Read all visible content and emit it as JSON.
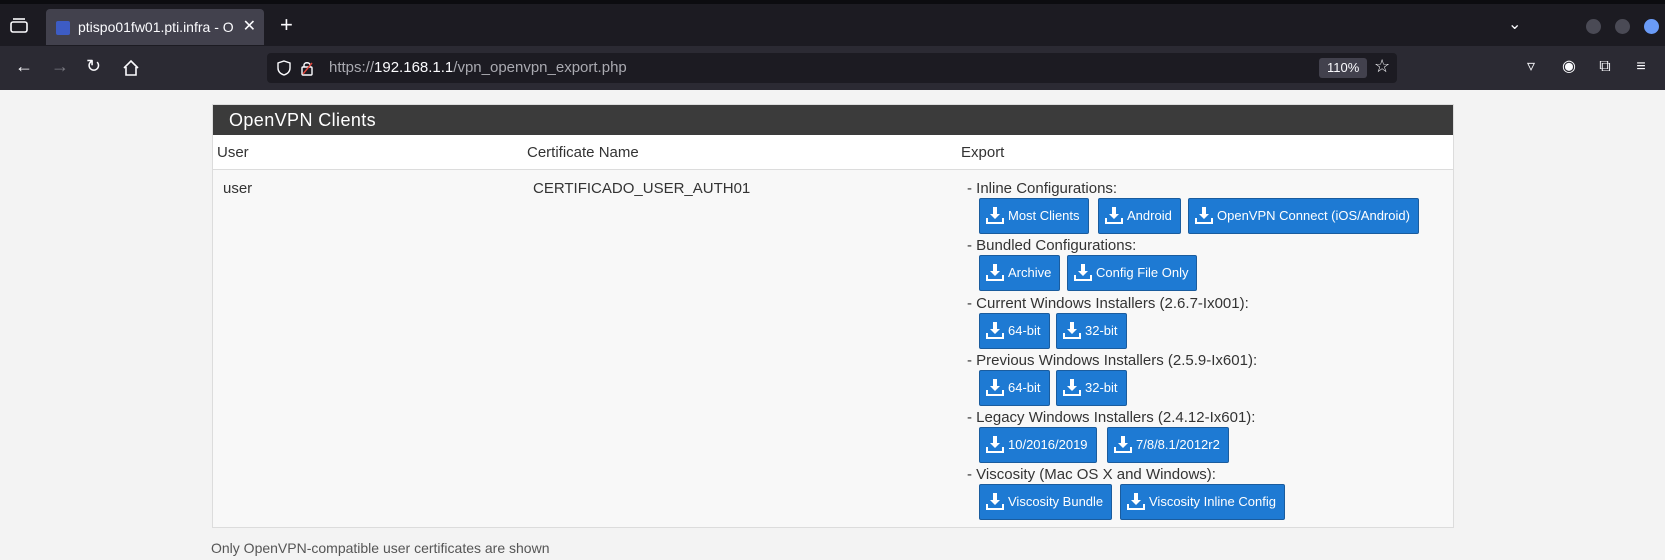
{
  "browser": {
    "tab_title": "ptispo01fw01.pti.infra - O",
    "url_scheme": "https://",
    "url_host": "192.168.1.1",
    "url_path": "/vpn_openvpn_export.php",
    "zoom": "110%"
  },
  "panel": {
    "title": "OpenVPN Clients",
    "columns": [
      "User",
      "Certificate Name",
      "Export"
    ]
  },
  "row": {
    "user": "user",
    "certificate": "CERTIFICADO_USER_AUTH01"
  },
  "export_groups": [
    {
      "label": "- Inline Configurations:",
      "buttons": [
        "Most Clients",
        "Android",
        "OpenVPN Connect (iOS/Android)"
      ]
    },
    {
      "label": "- Bundled Configurations:",
      "buttons": [
        "Archive",
        "Config File Only"
      ]
    },
    {
      "label": "- Current Windows Installers (2.6.7-Ix001):",
      "buttons": [
        "64-bit",
        "32-bit"
      ]
    },
    {
      "label": "- Previous Windows Installers (2.5.9-Ix601):",
      "buttons": [
        "64-bit",
        "32-bit"
      ]
    },
    {
      "label": "- Legacy Windows Installers (2.4.12-Ix601):",
      "buttons": [
        "10/2016/2019",
        "7/8/8.1/2012r2"
      ]
    },
    {
      "label": "- Viscosity (Mac OS X and Windows):",
      "buttons": [
        "Viscosity Bundle",
        "Viscosity Inline Config"
      ]
    }
  ],
  "footnote": "Only OpenVPN-compatible user certificates are shown",
  "colors": {
    "button": "#1e7ad3",
    "panel_header": "#3b3b3b"
  },
  "icons": [
    "download-icon",
    "shield-icon",
    "lock-icon",
    "star-icon",
    "pocket-icon",
    "account-icon",
    "extensions-icon",
    "menu-icon"
  ]
}
